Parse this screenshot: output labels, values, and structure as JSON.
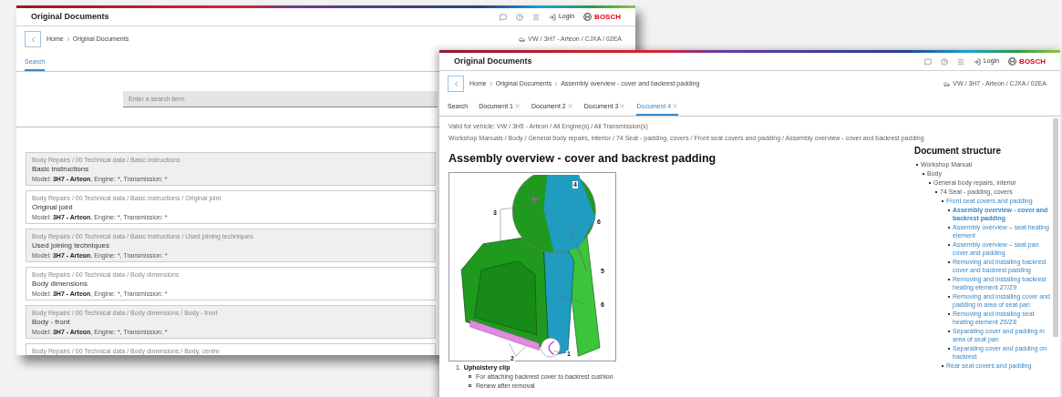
{
  "back_window": {
    "title": "Original Documents",
    "login": "Login",
    "brand": "BOSCH",
    "breadcrumb": [
      "Home",
      "Original Documents"
    ],
    "vehicle": "VW / 3H7 - Arteon / CJXA / 02EA",
    "tabs": [
      {
        "label": "Search",
        "selected": true
      }
    ],
    "search": {
      "placeholder": "Enter a search term"
    },
    "results": [
      {
        "path": "Body Repairs / 00 Technical data / Basic instructions",
        "title": "Basic instructions",
        "model_label": "Model:",
        "model": "3H7 - Arteon",
        "details": ", Engine: *, Transmission: *"
      },
      {
        "path": "Body Repairs / 00 Technical data / Basic instructions / Original joint",
        "title": "Original joint",
        "model_label": "Model:",
        "model": "3H7 - Arteon",
        "details": ", Engine: *, Transmission: *"
      },
      {
        "path": "Body Repairs / 00 Technical data / Basic instructions / Used joining techniques",
        "title": "Used joining techniques",
        "model_label": "Model:",
        "model": "3H7 - Arteon",
        "details": ", Engine: *, Transmission: *"
      },
      {
        "path": "Body Repairs / 00 Technical data / Body dimensions",
        "title": "Body dimensions",
        "model_label": "Model:",
        "model": "3H7 - Arteon",
        "details": ", Engine: *, Transmission: *"
      },
      {
        "path": "Body Repairs / 00 Technical data / Body dimensions / Body - front",
        "title": "Body - front",
        "model_label": "Model:",
        "model": "3H7 - Arteon",
        "details": ", Engine: *, Transmission: *"
      },
      {
        "path": "Body Repairs / 00 Technical data / Body dimensions / Body, centre"
      }
    ]
  },
  "front_window": {
    "title": "Original Documents",
    "login": "Login",
    "brand": "BOSCH",
    "breadcrumb": [
      "Home",
      "Original Documents",
      "Assembly overview - cover and backrest padding"
    ],
    "vehicle": "VW / 3H7 - Arteon / CJXA / 02EA",
    "tabs": [
      {
        "label": "Search",
        "selected": false,
        "closable": false
      },
      {
        "label": "Document 1",
        "selected": false,
        "closable": true
      },
      {
        "label": "Document 2",
        "selected": false,
        "closable": true
      },
      {
        "label": "Document 3",
        "selected": false,
        "closable": true
      },
      {
        "label": "Document 4",
        "selected": true,
        "closable": true
      }
    ],
    "validity": "Valid for vehicle: VW / 3H5 - Arteon / All Engine(s) / All Transmission(s)",
    "path": "Workshop Manuals / Body / General body repairs, interior / 74 Seat - padding, covers / Front seat covers and padding / Assembly overview - cover and backrest padding",
    "heading": "Assembly overview - cover and backrest padding",
    "figure": {
      "callouts": [
        "3",
        "4",
        "6",
        "5",
        "6",
        "2",
        "1"
      ]
    },
    "legend": [
      {
        "number": "1.",
        "title": "Upholstery clip",
        "notes": [
          "For attaching backrest cover to backrest cushion",
          "Renew after removal"
        ]
      }
    ],
    "structure": {
      "title": "Document structure",
      "tree": [
        {
          "label": "Workshop Manual",
          "kind": "text",
          "selected": false,
          "children": [
            {
              "label": "Body",
              "kind": "text",
              "selected": false,
              "children": [
                {
                  "label": "General body repairs, interior",
                  "kind": "text",
                  "selected": false,
                  "children": [
                    {
                      "label": "74 Seat - padding, covers",
                      "kind": "text",
                      "selected": false,
                      "children": [
                        {
                          "label": "Front seat covers and padding",
                          "kind": "link",
                          "selected": false,
                          "children": [
                            {
                              "label": "Assembly overview - cover and backrest padding",
                              "kind": "link",
                              "selected": true
                            },
                            {
                              "label": "Assembly overview – seat heating element",
                              "kind": "link",
                              "selected": false
                            },
                            {
                              "label": "Assembly overview – seat pan cover and padding",
                              "kind": "link",
                              "selected": false
                            },
                            {
                              "label": "Removing and installing backrest cover and backrest padding",
                              "kind": "link",
                              "selected": false
                            },
                            {
                              "label": "Removing and installing backrest heating element Z7/Z9",
                              "kind": "link",
                              "selected": false
                            },
                            {
                              "label": "Removing and installing cover and padding in area of seat pan",
                              "kind": "link",
                              "selected": false
                            },
                            {
                              "label": "Removing and installing seat heating element Z6/Z8",
                              "kind": "link",
                              "selected": false
                            },
                            {
                              "label": "Separating cover and padding in area of seat pan",
                              "kind": "link",
                              "selected": false
                            },
                            {
                              "label": "Separating cover and padding on backrest",
                              "kind": "link",
                              "selected": false
                            }
                          ]
                        },
                        {
                          "label": "Rear seat covers and padding",
                          "kind": "link",
                          "selected": false
                        }
                      ]
                    }
                  ]
                }
              ]
            }
          ]
        }
      ]
    }
  }
}
